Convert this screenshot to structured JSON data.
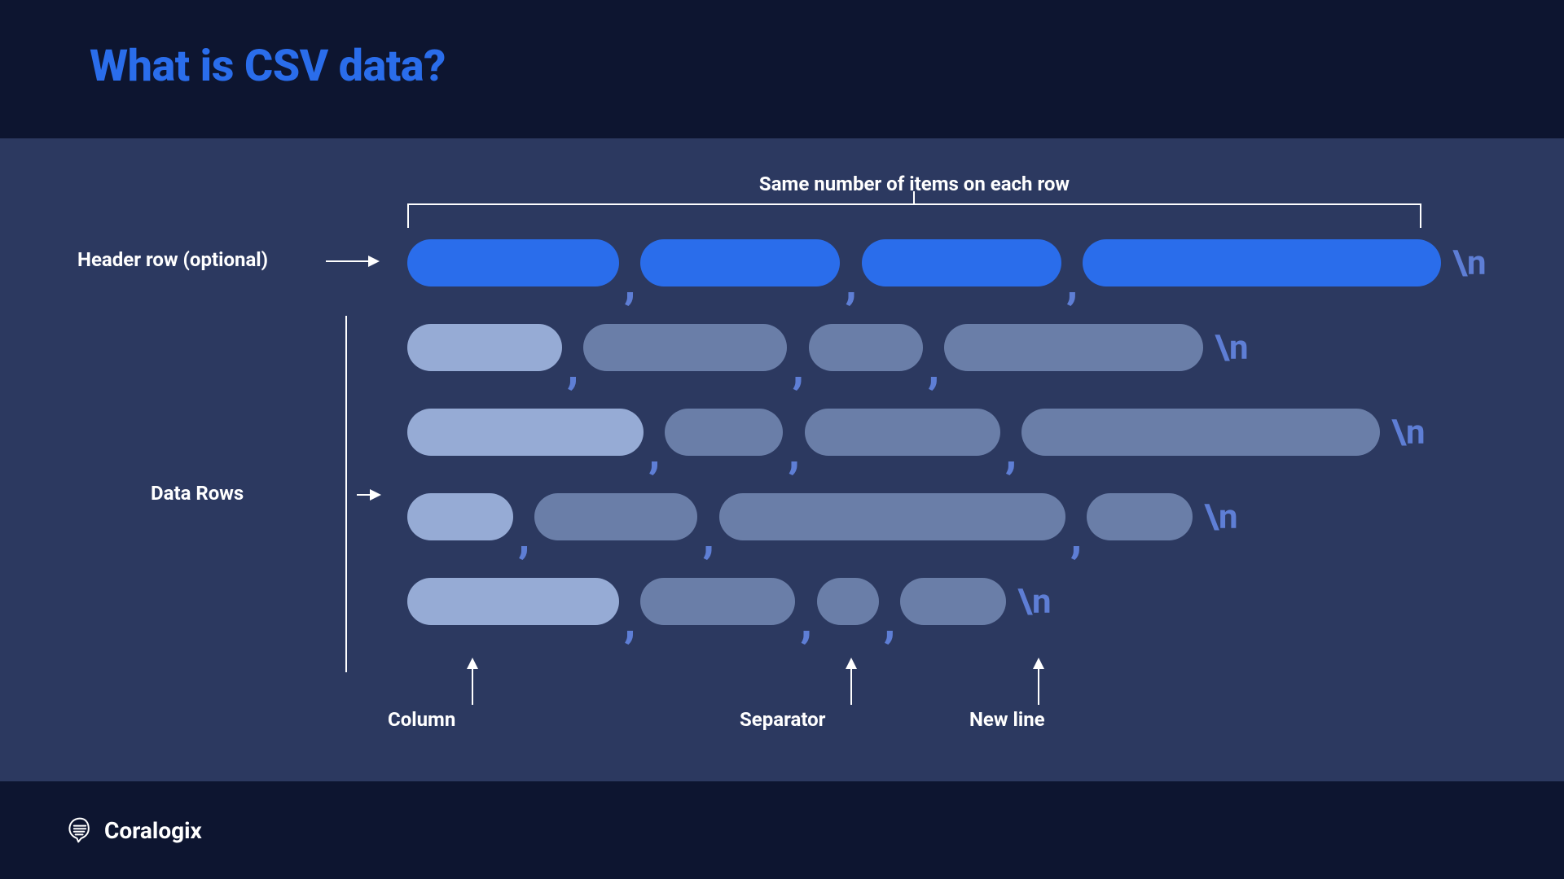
{
  "header": {
    "title": "What is CSV data?"
  },
  "labels": {
    "top_annotation": "Same number of items on each row",
    "header_row": "Header row (optional)",
    "data_rows": "Data Rows",
    "column": "Column",
    "separator": "Separator",
    "newline": "New line"
  },
  "rows": {
    "header": {
      "widths": [
        260,
        245,
        245,
        440
      ],
      "type": "header"
    },
    "data": [
      {
        "widths": [
          190,
          250,
          140,
          318
        ],
        "first_light": true
      },
      {
        "widths": [
          290,
          145,
          240,
          440
        ],
        "first_light": true
      },
      {
        "widths": [
          130,
          200,
          425,
          130
        ],
        "first_light": true
      },
      {
        "widths": [
          260,
          190,
          76,
          130
        ],
        "first_light": true
      }
    ]
  },
  "tokens": {
    "comma": ",",
    "newline": "\\n"
  },
  "logo": {
    "text": "Coralogix"
  }
}
